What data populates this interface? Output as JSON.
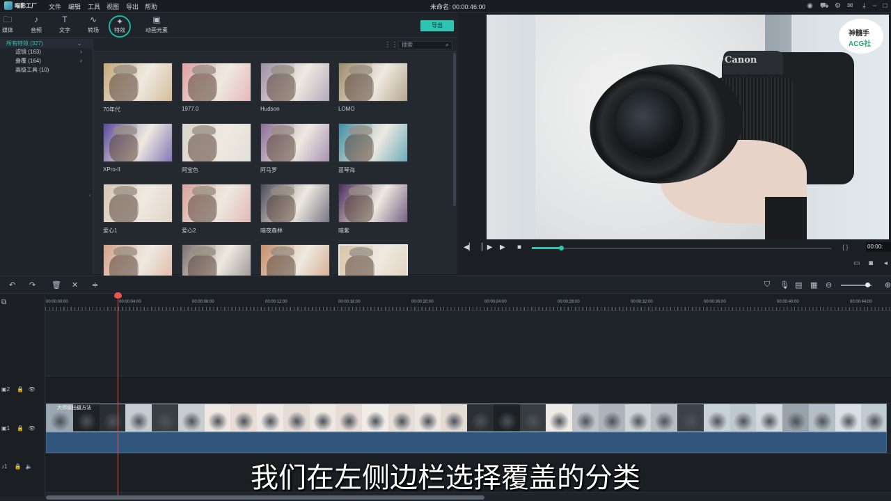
{
  "app": {
    "logo_text": "喵影工厂"
  },
  "menu": [
    "文件",
    "编辑",
    "工具",
    "视图",
    "导出",
    "帮助"
  ],
  "project_title": "未命名: 00:00:46:00",
  "toolbar": {
    "tools": [
      {
        "icon": "folder-icon",
        "label": "媒体"
      },
      {
        "icon": "music-note-icon",
        "label": "音频"
      },
      {
        "icon": "text-icon",
        "label": "文字"
      },
      {
        "icon": "transition-icon",
        "label": "转场"
      },
      {
        "icon": "effects-icon",
        "label": "特效"
      },
      {
        "icon": "image-icon",
        "label": "动画元素"
      }
    ],
    "export_label": "导出"
  },
  "sidebar": {
    "items": [
      {
        "label": "所有特效 (327)",
        "selected": true
      },
      {
        "label": "滤镜 (163)",
        "expandable": true
      },
      {
        "label": "叠覆 (164)",
        "expandable": true
      },
      {
        "label": "高级工具 (10)"
      }
    ]
  },
  "grid": {
    "search_placeholder": "搜索",
    "items": [
      {
        "label": "70年代",
        "tint": "#c7a77a"
      },
      {
        "label": "1977.0",
        "tint": "#e0a0a6"
      },
      {
        "label": "Hudson",
        "tint": "#9c8fa6"
      },
      {
        "label": "LOMO",
        "tint": "#9d8a6a"
      },
      {
        "label": "XPro-II",
        "tint": "#5a4b9c"
      },
      {
        "label": "阿宝色",
        "tint": "#d9d5cc"
      },
      {
        "label": "阿马罗",
        "tint": "#8c6e9a"
      },
      {
        "label": "蓝琴海",
        "tint": "#3e8fa5"
      },
      {
        "label": "爱心1",
        "tint": "#d8c6b6"
      },
      {
        "label": "爱心2",
        "tint": "#d9a39c"
      },
      {
        "label": "暗夜森林",
        "tint": "#4a4a5a"
      },
      {
        "label": "暗紫",
        "tint": "#4b2c5c"
      },
      {
        "label": "",
        "tint": "#d6a28a"
      },
      {
        "label": "",
        "tint": "#7a7170"
      },
      {
        "label": "",
        "tint": "#c58f6a"
      },
      {
        "label": "",
        "tint": "#d9c4a8"
      }
    ]
  },
  "preview": {
    "watermark_line1": "神髓手",
    "watermark_line2": "ACG社",
    "camera_brand": "Canon",
    "time": "00:00:",
    "progress": 0.1,
    "braces": "{ }"
  },
  "timeline": {
    "ruler_labels": [
      "00:00:00:00",
      "00:00:04:00",
      "00:00:08:00",
      "00:00:12:00",
      "00:00:16:00",
      "00:00:20:00",
      "00:00:24:00",
      "00:00:28:00",
      "00:00:32:00",
      "00:00:36:00",
      "00:00:40:00",
      "00:00:44:00"
    ],
    "tracks": [
      {
        "label": "2"
      },
      {
        "label": "1"
      },
      {
        "label": "1"
      }
    ],
    "clip_title": "大师级拍摄方法",
    "zoom_level": 0.8
  },
  "subtitle": "我们在左侧边栏选择覆盖的分类",
  "colors": {
    "accent": "#2dc5b2",
    "playhead": "#ef5350",
    "audio_clip": "#31557c"
  }
}
